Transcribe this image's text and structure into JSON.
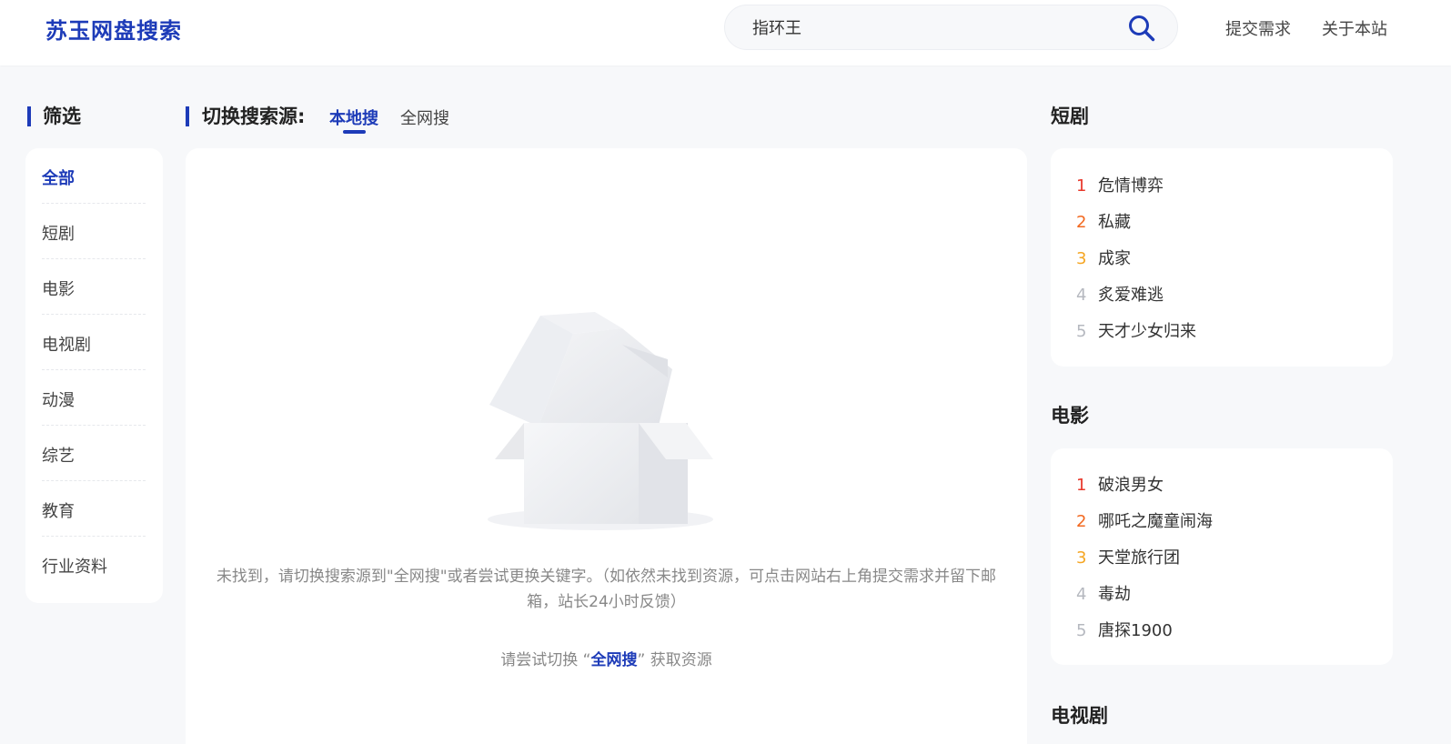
{
  "header": {
    "logo": "苏玉网盘搜索",
    "search_value": "指环王",
    "nav": {
      "submit": "提交需求",
      "about": "关于本站"
    }
  },
  "filter": {
    "title": "筛选",
    "items": [
      "全部",
      "短剧",
      "电影",
      "电视剧",
      "动漫",
      "综艺",
      "教育",
      "行业资料"
    ],
    "active_index": 0
  },
  "source": {
    "title": "切换搜索源:",
    "tabs": [
      "本地搜",
      "全网搜"
    ],
    "active_index": 0
  },
  "empty": {
    "message": "未找到，请切换搜索源到\"全网搜\"或者尝试更换关键字。（如依然未找到资源，可点击网站右上角提交需求并留下邮箱，站长24小时反馈）",
    "hint_prefix": "请尝试切换 “",
    "hint_link": "全网搜",
    "hint_suffix": "” 获取资源"
  },
  "rankings": [
    {
      "title": "短剧",
      "items": [
        {
          "rank": "1",
          "name": "危情博弈"
        },
        {
          "rank": "2",
          "name": "私藏"
        },
        {
          "rank": "3",
          "name": "成家"
        },
        {
          "rank": "4",
          "name": "炙爱难逃"
        },
        {
          "rank": "5",
          "name": "天才少女归来"
        }
      ]
    },
    {
      "title": "电影",
      "items": [
        {
          "rank": "1",
          "name": "破浪男女"
        },
        {
          "rank": "2",
          "name": "哪吒之魔童闹海"
        },
        {
          "rank": "3",
          "name": "天堂旅行团"
        },
        {
          "rank": "4",
          "name": "毒劫"
        },
        {
          "rank": "5",
          "name": "唐探1900"
        }
      ]
    },
    {
      "title": "电视剧",
      "items": []
    }
  ],
  "colors": {
    "accent": "#1d3bb8",
    "rank1": "#e8382b",
    "rank2": "#f2681f",
    "rank3": "#f5a623",
    "rank_other": "#b5b8bf"
  }
}
